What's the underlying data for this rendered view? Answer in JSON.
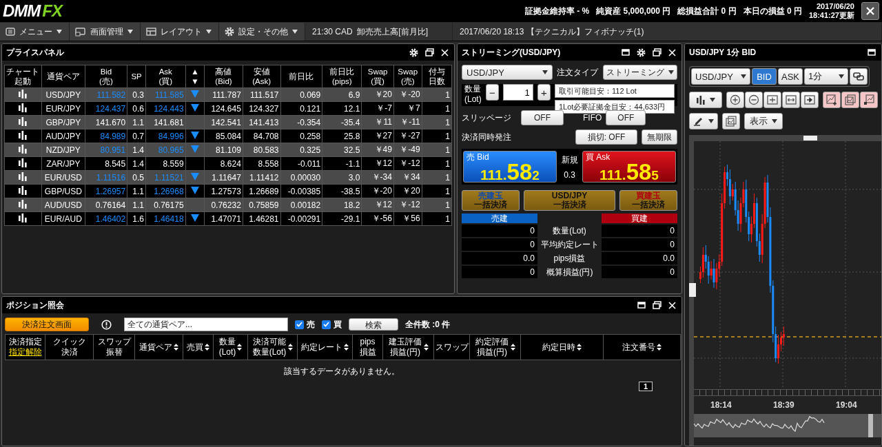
{
  "header": {
    "logo": {
      "main": "DMM",
      "accent": "FX"
    },
    "account": [
      {
        "label": "証拠金維持率",
        "value": "- %"
      },
      {
        "label": "純資産",
        "value": "5,000,000 円"
      },
      {
        "label": "総損益合計",
        "value": "0 円"
      },
      {
        "label": "本日の損益",
        "value": "0 円"
      }
    ],
    "updated_date": "2017/06/20",
    "updated_time": "18:41:27更新"
  },
  "menu": [
    "メニュー",
    "画面管理",
    "レイアウト",
    "設定・その他"
  ],
  "news": [
    {
      "time": "21:30",
      "text": "CAD  卸売売上高[前月比]"
    },
    {
      "time": "2017/06/20 18:13",
      "text": "【テクニカル】フィボナッチ(1)"
    }
  ],
  "price_panel": {
    "title": "プライスパネル",
    "columns": [
      "チャート起動",
      "通貨ペア",
      "Bid\n(売)",
      "SP",
      "Ask\n(買)",
      "▲\n▼",
      "高値\n(Bid)",
      "安値\n(Ask)",
      "前日比",
      "前日比\n(pips)",
      "Swap\n(買)",
      "Swap\n(売)",
      "付与日数"
    ],
    "rows": [
      {
        "pair": "USD/JPY",
        "bid": "111.582",
        "sp": "0.3",
        "ask": "111.585",
        "down_tick": true,
        "high": "111.787",
        "low": "111.517",
        "change": "0.069",
        "change_pips": "6.9",
        "swap_buy": "￥20",
        "swap_sell": "￥-20",
        "days": "1"
      },
      {
        "pair": "EUR/JPY",
        "bid": "124.437",
        "sp": "0.6",
        "ask": "124.443",
        "down_tick": true,
        "high": "124.645",
        "low": "124.327",
        "change": "0.121",
        "change_pips": "12.1",
        "swap_buy": "￥-7",
        "swap_sell": "￥7",
        "days": "1"
      },
      {
        "pair": "GBP/JPY",
        "bid": "141.670",
        "sp": "1.1",
        "ask": "141.681",
        "down_tick": false,
        "high": "142.541",
        "low": "141.413",
        "change": "-0.354",
        "change_pips": "-35.4",
        "swap_buy": "￥11",
        "swap_sell": "￥-11",
        "days": "1"
      },
      {
        "pair": "AUD/JPY",
        "bid": "84.989",
        "sp": "0.7",
        "ask": "84.996",
        "down_tick": true,
        "high": "85.084",
        "low": "84.708",
        "change": "0.258",
        "change_pips": "25.8",
        "swap_buy": "￥27",
        "swap_sell": "￥-27",
        "days": "1"
      },
      {
        "pair": "NZD/JPY",
        "bid": "80.951",
        "sp": "1.4",
        "ask": "80.965",
        "down_tick": true,
        "high": "81.109",
        "low": "80.583",
        "change": "0.325",
        "change_pips": "32.5",
        "swap_buy": "￥49",
        "swap_sell": "￥-49",
        "days": "1"
      },
      {
        "pair": "ZAR/JPY",
        "bid": "8.545",
        "sp": "1.4",
        "ask": "8.559",
        "down_tick": false,
        "high": "8.624",
        "low": "8.558",
        "change": "-0.011",
        "change_pips": "-1.1",
        "swap_buy": "￥12",
        "swap_sell": "￥-12",
        "days": "1"
      },
      {
        "pair": "EUR/USD",
        "bid": "1.11516",
        "sp": "0.5",
        "ask": "1.11521",
        "down_tick": true,
        "high": "1.11647",
        "low": "1.11412",
        "change": "0.00030",
        "change_pips": "3.0",
        "swap_buy": "￥-34",
        "swap_sell": "￥34",
        "days": "1"
      },
      {
        "pair": "GBP/USD",
        "bid": "1.26957",
        "sp": "1.1",
        "ask": "1.26968",
        "down_tick": true,
        "high": "1.27573",
        "low": "1.26689",
        "change": "-0.00385",
        "change_pips": "-38.5",
        "swap_buy": "￥-20",
        "swap_sell": "￥20",
        "days": "1"
      },
      {
        "pair": "AUD/USD",
        "bid": "0.76164",
        "sp": "1.1",
        "ask": "0.76175",
        "down_tick": false,
        "high": "0.76232",
        "low": "0.75859",
        "change": "0.00182",
        "change_pips": "18.2",
        "swap_buy": "￥12",
        "swap_sell": "￥-12",
        "days": "1"
      },
      {
        "pair": "EUR/AUD",
        "bid": "1.46402",
        "sp": "1.6",
        "ask": "1.46418",
        "down_tick": true,
        "high": "1.47071",
        "low": "1.46281",
        "change": "-0.00291",
        "change_pips": "-29.1",
        "swap_buy": "￥-56",
        "swap_sell": "￥56",
        "days": "1"
      }
    ]
  },
  "streaming": {
    "title": "ストリーミング(USD/JPY)",
    "pair": "USD/JPY",
    "order_type_label": "注文タイプ",
    "order_type": "ストリーミング",
    "quantity_label": "数量\n(Lot)",
    "minus": "−",
    "quantity": "1",
    "plus": "+",
    "info": [
      "取引可能目安：112 Lot",
      "1Lot必要証拠金目安：44,633円"
    ],
    "slippage_label": "スリッページ",
    "slippage": "OFF",
    "fifo_label": "FIFO",
    "fifo": "OFF",
    "settle_label": "決済同時発注",
    "stop_loss": "損切: OFF",
    "expiry": "無期限",
    "bid": {
      "label": "売 Bid",
      "big": "111.",
      "main": "58",
      "small": "2"
    },
    "spread_label": "新規",
    "spread": "0.3",
    "ask": {
      "label": "買 Ask",
      "big": "111.",
      "main": "58",
      "small": "5"
    },
    "bulk": [
      {
        "top": "売建玉",
        "bottom": "一括決済",
        "color": "#0a4ab0"
      },
      {
        "top": "USD/JPY",
        "bottom": "一括決済"
      },
      {
        "top": "買建玉",
        "bottom": "一括決済",
        "color": "#b00010"
      }
    ],
    "sell_header": "売建",
    "buy_header": "買建",
    "summary": [
      {
        "label": "数量(Lot)",
        "sell": "0",
        "buy": "0"
      },
      {
        "label": "平均約定レート",
        "sell": "0",
        "buy": "0"
      },
      {
        "label": "pips損益",
        "sell": "0.0",
        "buy": "0.0"
      },
      {
        "label": "概算損益(円)",
        "sell": "0",
        "buy": "0"
      }
    ]
  },
  "chart": {
    "title": "USD/JPY 1分 BID",
    "pair": "USD/JPY",
    "sides": [
      {
        "label": "BID",
        "selected": true
      },
      {
        "label": "ASK",
        "selected": false
      }
    ],
    "interval": "1分",
    "view_button": "表示",
    "x_labels": [
      "18:14",
      "18:39",
      "19:04"
    ]
  },
  "positions": {
    "title": "ポジション照会",
    "settle_button": "決済注文画面",
    "pair_filter": "全ての通貨ペア...",
    "checks": [
      {
        "label": "売",
        "checked": true
      },
      {
        "label": "買",
        "checked": true
      }
    ],
    "search": "検索",
    "count": "全件数 :0 件",
    "columns": [
      {
        "label": "決済指定",
        "link": "指定解除",
        "sortable": false
      },
      {
        "label": "クイック決済",
        "sortable": false
      },
      {
        "label": "スワップ振替",
        "sortable": false
      },
      {
        "label": "通貨ペア",
        "sortable": true
      },
      {
        "label": "売買",
        "sortable": true
      },
      {
        "label": "数量\n(Lot)",
        "sortable": true
      },
      {
        "label": "決済可能数量(Lot)",
        "sortable": true
      },
      {
        "label": "約定レート",
        "sortable": true
      },
      {
        "label": "pips\n損益",
        "sortable": false
      },
      {
        "label": "建玉評価損益(円)",
        "sortable": true
      },
      {
        "label": "スワップ",
        "sortable": false
      },
      {
        "label": "約定評価損益(円)",
        "sortable": true
      },
      {
        "label": "約定日時",
        "sortable": true
      },
      {
        "label": "注文番号",
        "sortable": true
      }
    ],
    "empty": "該当するデータがありません。",
    "page": "1"
  }
}
